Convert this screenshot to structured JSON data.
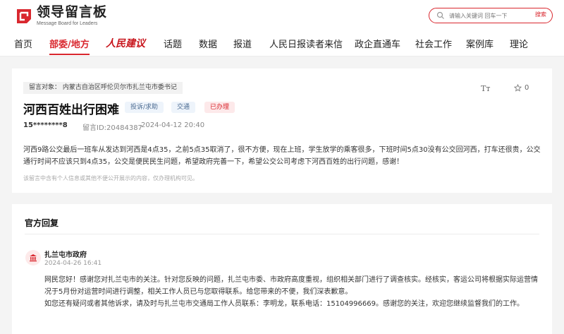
{
  "header": {
    "logo_cn": "领导留言板",
    "logo_en": "Message Board for Leaders",
    "search_placeholder": "请输入关键词 回车一下",
    "search_button": "搜索"
  },
  "nav": [
    {
      "label": "首页"
    },
    {
      "label": "部委/地方"
    },
    {
      "label": "人民建议"
    },
    {
      "label": "话题"
    },
    {
      "label": "数据"
    },
    {
      "label": "报道"
    },
    {
      "label": "人民日报读者来信"
    },
    {
      "label": "政企直通车"
    },
    {
      "label": "社会工作"
    },
    {
      "label": "案例库"
    },
    {
      "label": "理论"
    }
  ],
  "message": {
    "target": "留言对象：  内蒙古自治区呼伦贝尔市扎兰屯市委书记",
    "font_icon": "Tт",
    "star_count": "0",
    "title": "河西百姓出行困难",
    "type_badge": "投诉/求助",
    "area_badge": "交通",
    "status_badge": "已办理",
    "user": "15********8",
    "id": "留言ID:20484387",
    "time": "2024-04-12 20:40",
    "body": "河西9路公交最后一班车从发达到河西是4点35，之前5点35取消了，很不方便，现在上班，学生放学的乘客很多，下班时间5点30没有公交回河西，打车还很贵，公交通行时间不应该只到4点35，公交是便民民生问题，希望政府完善一下，希望公交公司考虑下河西百姓的出行问题，感谢！",
    "note": "该留言中含有个人信息或其他不便公开展示的内容，仅办理机构可见。"
  },
  "reply": {
    "heading": "官方回复",
    "org_name": "扎兰屯市政府",
    "date": "2024-04-26 16:41",
    "body1": "网民您好！感谢您对扎兰屯市的关注。针对您反映的问题，扎兰屯市委、市政府高度重视，组织相关部门进行了调查核实。经核实，客运公司将根据实际运营情况于5月份对运营时间进行调整，相关工作人员已与您取得联系。给您带来的不便，我们深表歉意。",
    "body2": "如您还有疑问或者其他诉求，请及时与扎兰屯市交通局工作人员联系：李明龙，联系电话：15104996669。感谢您的关注，欢迎您继续监督我们的工作。"
  },
  "colors": {
    "accent": "#d9272e"
  }
}
